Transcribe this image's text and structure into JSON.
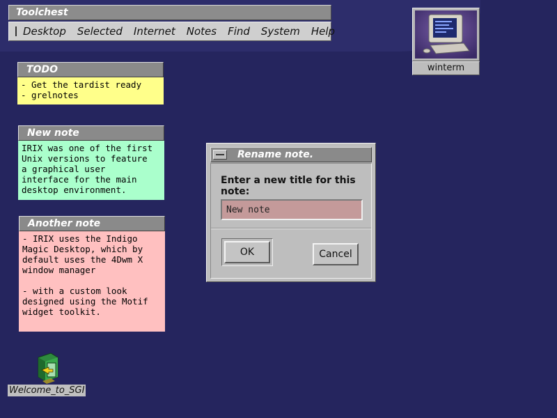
{
  "toolchest": {
    "title": "Toolchest",
    "menu": [
      "Desktop",
      "Selected",
      "Internet",
      "Notes",
      "Find",
      "System",
      "Help"
    ]
  },
  "notes": [
    {
      "title": "TODO",
      "body": "- Get the tardist ready\n- grelnotes",
      "color": "#ffff8a"
    },
    {
      "title": "New note",
      "body": "IRIX was one of the first\nUnix versions to feature\na graphical user\ninterface for the main\ndesktop environment.",
      "color": "#aaffcc"
    },
    {
      "title": "Another note",
      "body": "- IRIX uses the Indigo\nMagic Desktop, which by\ndefault uses the 4Dwm X\nwindow manager\n\n- with a custom look\ndesigned using the Motif\nwidget toolkit.",
      "color": "#ffc0c0"
    }
  ],
  "desktop_icons": {
    "winterm": {
      "label": "winterm",
      "icon": "terminal-computer-icon"
    },
    "welcome": {
      "label": "Welcome_to_SGI",
      "icon": "sgi-welcome-icon"
    }
  },
  "dialog": {
    "title": "Rename note.",
    "prompt": "Enter a new title for this note:",
    "input_value": "New note",
    "ok_label": "OK",
    "cancel_label": "Cancel"
  },
  "colors": {
    "desktop": "#25255e",
    "input_bg": "#c49a9a",
    "window_gray": "#bebebe"
  }
}
